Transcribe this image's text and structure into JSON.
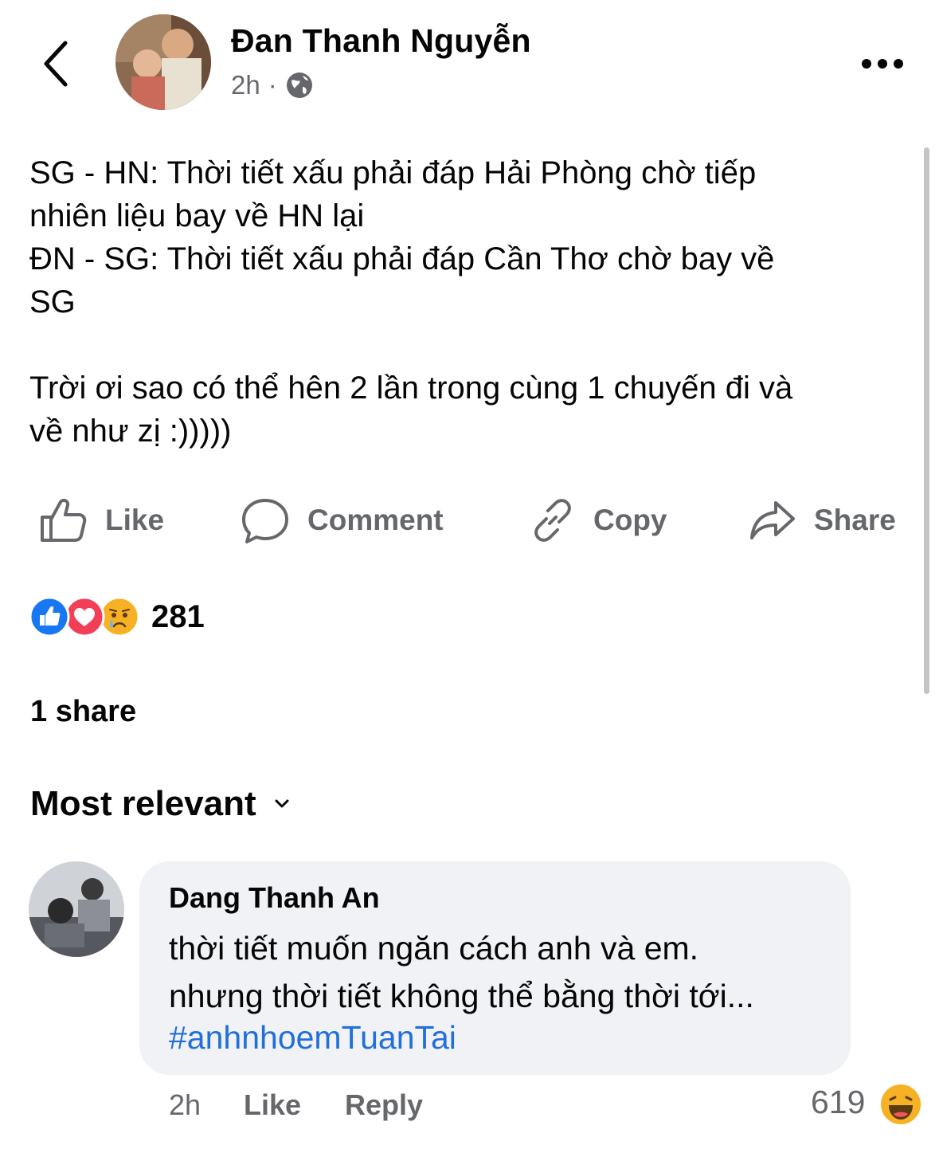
{
  "header": {
    "author": "Đan Thanh Nguyễn",
    "time": "2h",
    "separator": "·",
    "privacy_icon": "globe-icon"
  },
  "post": {
    "text": "SG - HN: Thời tiết xấu phải đáp Hải Phòng chờ tiếp\nnhiên liệu bay về HN lại\nĐN - SG: Thời tiết xấu phải đáp Cần Thơ chờ bay về\nSG\n\nTrời ơi sao có thể hên 2 lần trong cùng 1 chuyến đi và\nvề như zị :)))))"
  },
  "actions": {
    "like": "Like",
    "comment": "Comment",
    "copy": "Copy",
    "share": "Share"
  },
  "reactions": {
    "count": "281",
    "icons": [
      "like-reaction-icon",
      "love-reaction-icon",
      "sad-reaction-icon"
    ]
  },
  "shares": "1 share",
  "sort_label": "Most relevant",
  "comment": {
    "author": "Dang Thanh An",
    "text": "thời tiết muốn ngăn cách anh và em.\nnhưng thời tiết không thể bằng thời tới...",
    "hashtag": "#anhnhoemTuanTai",
    "time": "2h",
    "like": "Like",
    "reply": "Reply",
    "reaction_count": "619",
    "reaction_icon": "haha-reaction-icon"
  },
  "colors": {
    "secondary_text": "#65676b",
    "link": "#216fdb",
    "bubble": "#f0f2f5",
    "like_blue": "#1877f2",
    "love_red": "#f33e58",
    "emoji_yellow": "#f7b125"
  }
}
